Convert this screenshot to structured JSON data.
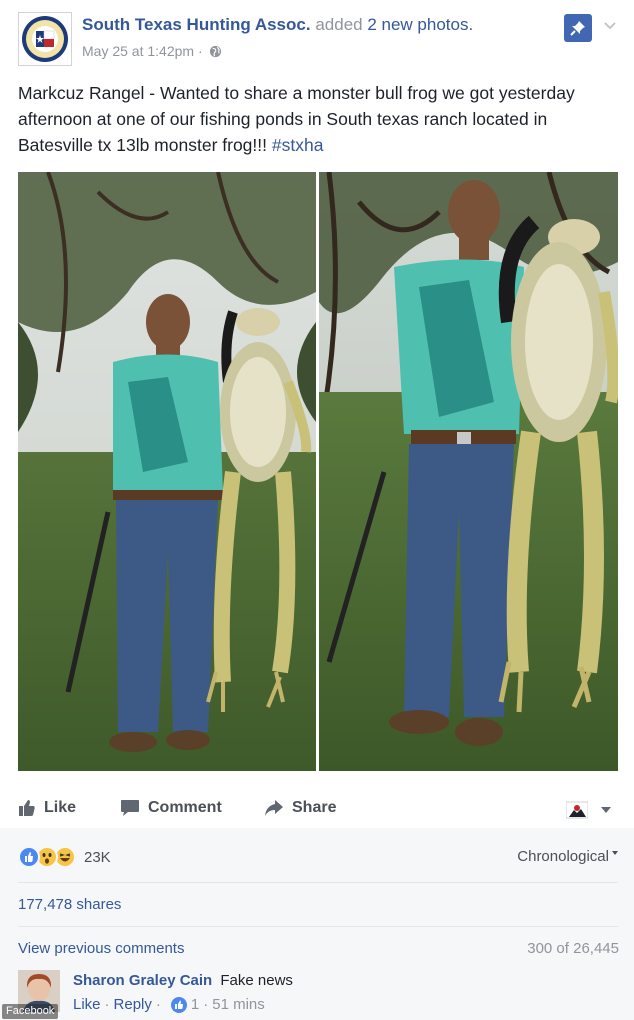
{
  "header": {
    "page_name": "South Texas Hunting Assoc.",
    "action_text": "added",
    "action_link": "2 new photos.",
    "timestamp": "May 25 at 1:42pm",
    "separator": "·"
  },
  "post": {
    "text": "Markcuz Rangel - Wanted to share a monster bull frog we got yesterday afternoon at one of our fishing ponds in South texas ranch located in Batesville tx 13lb monster frog!!!",
    "hashtag": "#stxha"
  },
  "actions": {
    "like": "Like",
    "comment": "Comment",
    "share": "Share"
  },
  "reactions": {
    "types": [
      "like",
      "wow",
      "haha"
    ],
    "count": "23K"
  },
  "sort_label": "Chronological",
  "shares_text": "177,478 shares",
  "view_previous": "View previous comments",
  "comment_count": "300 of 26,445",
  "comment": {
    "author": "Sharon Graley Cain",
    "text": "Fake news",
    "like_label": "Like",
    "reply_label": "Reply",
    "separator": "·",
    "like_count": "1",
    "time": "51 mins"
  },
  "watermark": "Facebook",
  "colors": {
    "link": "#365899",
    "brand": "#4267b2",
    "secondary_text": "#90949c"
  },
  "icons": [
    "page-avatar-seal",
    "globe-icon",
    "pin-icon",
    "chevron-down-icon",
    "like-icon",
    "comment-icon",
    "share-icon",
    "audience-icon"
  ]
}
